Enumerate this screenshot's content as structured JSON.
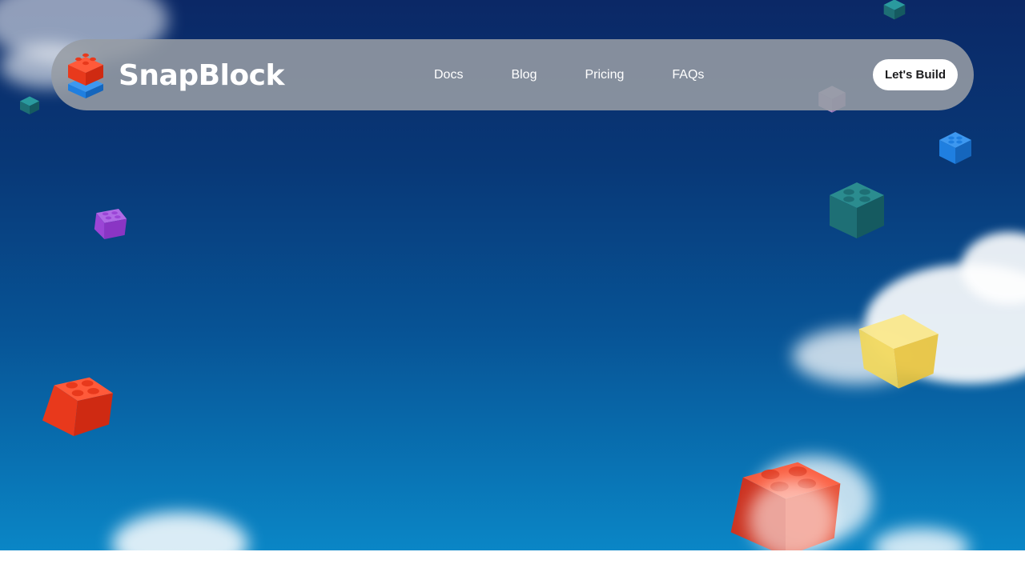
{
  "brand": {
    "name": "SnapBlock",
    "logo_icon": "stacked-blocks-icon"
  },
  "nav": {
    "links": [
      {
        "label": "Docs"
      },
      {
        "label": "Blog"
      },
      {
        "label": "Pricing"
      },
      {
        "label": "FAQs"
      }
    ],
    "cta_label": "Let's Build"
  },
  "colors": {
    "sky_top": "#0b2866",
    "sky_bottom": "#0a86c6",
    "nav_bg": "#969ca4",
    "cta_bg": "#ffffff",
    "brick_red": "#e8391c",
    "brick_blue": "#1f7fe0",
    "brick_teal": "#1e6f75",
    "brick_purple": "#9b45d6",
    "brick_yellow": "#f2d85a",
    "brick_pink": "#d9a6de"
  },
  "decor": {
    "bricks": [
      "red-brick-icon",
      "blue-brick-icon",
      "teal-brick-icon",
      "purple-brick-icon",
      "yellow-brick-icon",
      "pink-brick-icon"
    ]
  }
}
